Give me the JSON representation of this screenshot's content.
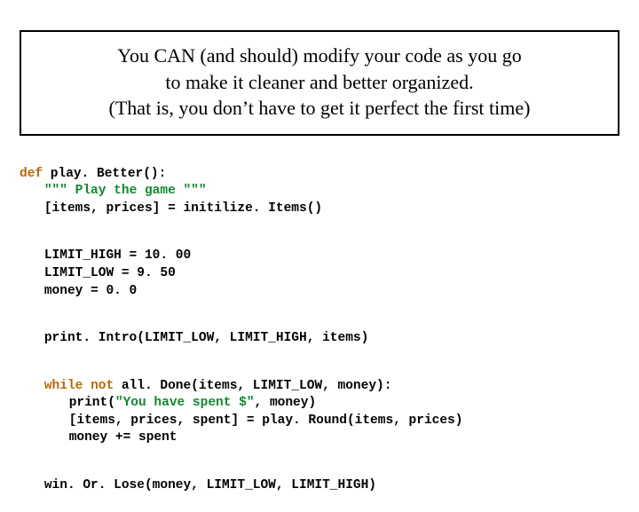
{
  "note": {
    "line1": "You CAN (and should) modify your code as you go",
    "line2": "to make it cleaner and better organized.",
    "line3": "(That is, you don’t have to get it perfect the first time)"
  },
  "code": {
    "kw_def": "def",
    "kw_while": "while",
    "kw_not": "not",
    "l1_rest": " play. Better():",
    "l2_a": "\"\"\"",
    "l2_b": " Play the game ",
    "l2_c": "\"\"\"",
    "l3": "[items, prices] = initilize. Items()",
    "l5": "LIMIT_HIGH = 10. 00",
    "l6": "LIMIT_LOW = 9. 50",
    "l7": "money = 0. 0",
    "l9": "print. Intro(LIMIT_LOW, LIMIT_HIGH, items)",
    "l11_rest": " all. Done(items, LIMIT_LOW, money):",
    "l12_a": "print(",
    "l12_b": "\"You have spent $\"",
    "l12_c": ", money)",
    "l13": "[items, prices, spent] = play. Round(items, prices)",
    "l14": "money += spent",
    "l16": "win. Or. Lose(money, LIMIT_LOW, LIMIT_HIGH)"
  }
}
